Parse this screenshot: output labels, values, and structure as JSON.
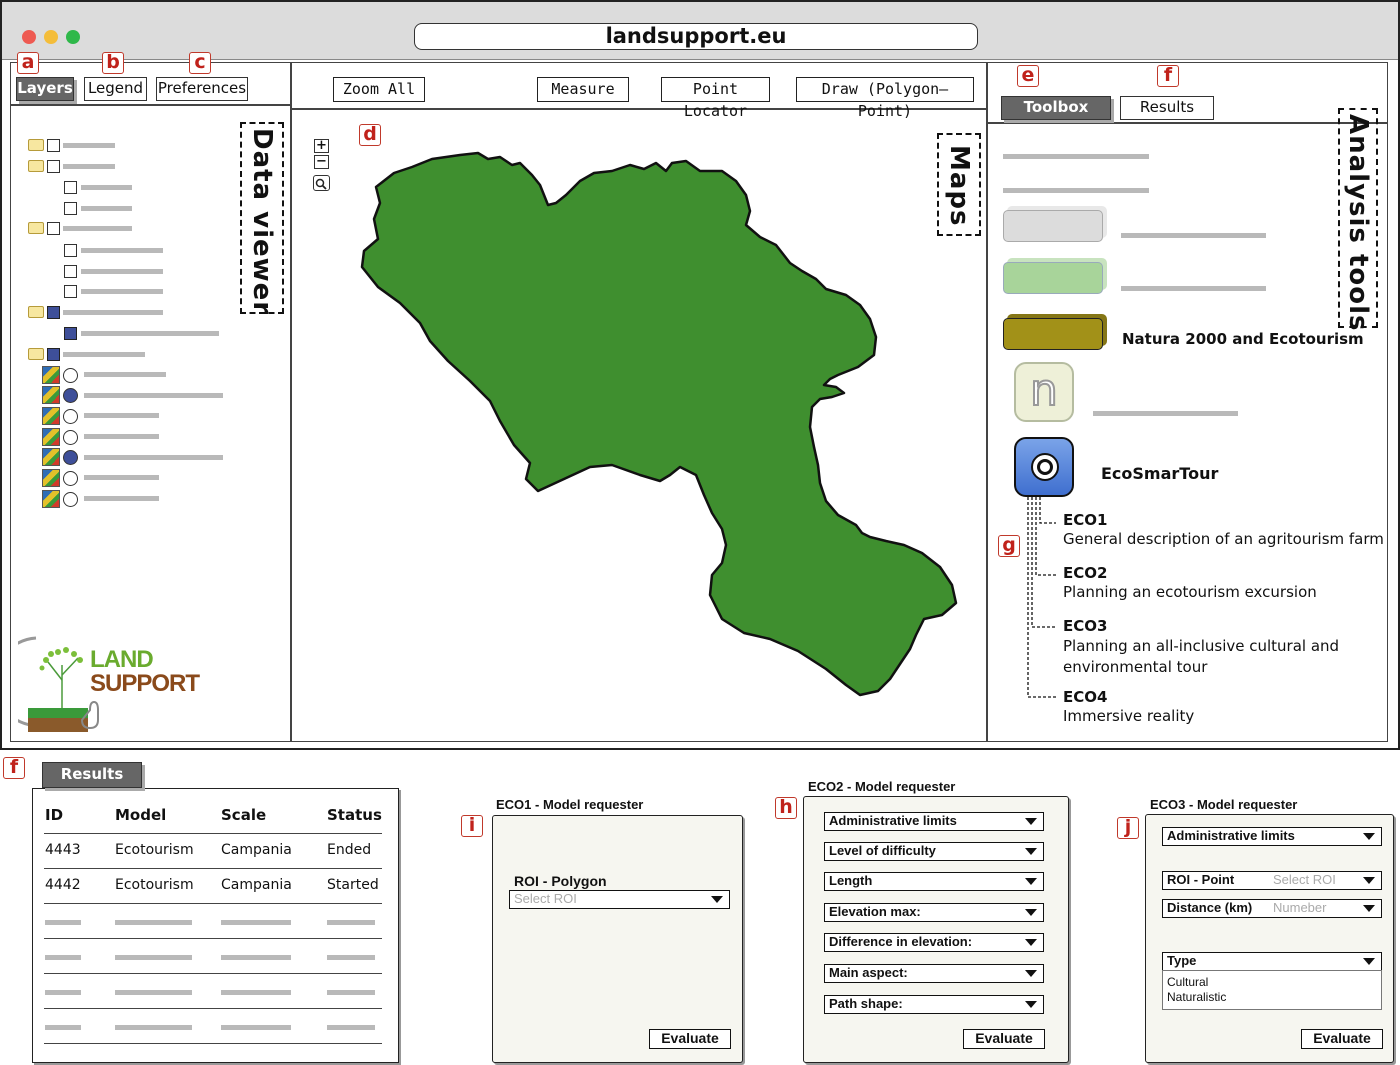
{
  "browser": {
    "url": "landsupport.eu"
  },
  "markers": {
    "a": "a",
    "b": "b",
    "c": "c",
    "d": "d",
    "e": "e",
    "f": "f",
    "f2": "f",
    "g": "g",
    "h": "h",
    "i": "i",
    "j": "j"
  },
  "left_panel": {
    "tabs": [
      "Layers",
      "Legend",
      "Preferences"
    ],
    "label": "Data viewer"
  },
  "logo": {
    "line1": "LAND",
    "line2": "SUPPORT"
  },
  "toolbar": {
    "zoom_all": "Zoom All",
    "measure": "Measure",
    "point_locator": "Point Locator",
    "draw": "Draw (Polygon–Point)"
  },
  "map": {
    "label": "Maps",
    "zoom_in": "+",
    "zoom_out": "−",
    "fill_color": "#3f8f2f"
  },
  "right_panel": {
    "tabs": [
      "Toolbox",
      "Results"
    ],
    "label": "Analysis tools",
    "natura": "Natura 2000 and Ecotourism",
    "n_icon": "n",
    "ecosmartour": "EcoSmarTour",
    "eco_items": [
      {
        "code": "ECO1",
        "desc": "General description of an agritourism farm"
      },
      {
        "code": "ECO2",
        "desc": "Planning an ecotourism excursion"
      },
      {
        "code": "ECO3",
        "desc": "Planning an all-inclusive cultural and environmental tour"
      },
      {
        "code": "ECO4",
        "desc": "Immersive reality"
      }
    ]
  },
  "results": {
    "tab": "Results",
    "headers": [
      "ID",
      "Model",
      "Scale",
      "Status"
    ],
    "rows": [
      [
        "4443",
        "Ecotourism",
        "Campania",
        "Ended"
      ],
      [
        "4442",
        "Ecotourism",
        "Campania",
        "Started"
      ]
    ]
  },
  "eco1": {
    "title": "ECO1 - Model requester",
    "roi_label": "ROI - Polygon",
    "roi_placeholder": "Select ROI",
    "evaluate": "Evaluate"
  },
  "eco2": {
    "title": "ECO2 - Model requester",
    "fields": [
      "Administrative limits",
      "Level of difficulty",
      "Length",
      "Elevation max:",
      "Difference in elevation:",
      "Main aspect:",
      "Path shape:"
    ],
    "evaluate": "Evaluate"
  },
  "eco3": {
    "title": "ECO3 - Model requester",
    "admin": "Administrative limits",
    "roi_point": "ROI - Point",
    "roi_placeholder": "Select ROI",
    "distance": "Distance (km)",
    "distance_placeholder": "Numeber",
    "type": "Type",
    "options": [
      "Cultural",
      "Naturalistic"
    ],
    "evaluate": "Evaluate"
  }
}
